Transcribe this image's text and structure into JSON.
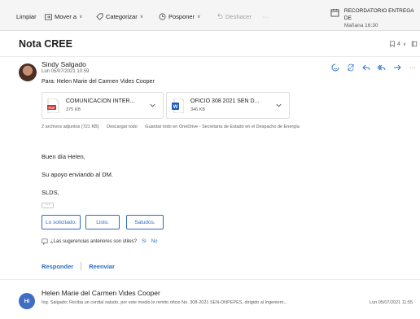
{
  "toolbar": {
    "limpiar": "Limpiar",
    "mover": "Mover a",
    "categorizar": "Categorizar",
    "posponer": "Posponer",
    "deshacer": "Deshacer",
    "more": "···",
    "reminder_title": "RECORDATORIO ENTREGA DE",
    "reminder_time": "Mañana 16:30"
  },
  "subject": {
    "title": "Nota CREE",
    "count": "4"
  },
  "message": {
    "sender": "Sindy Salgado",
    "date": "Lun 05/07/2021 10:59",
    "to": "Para:  Helen Marie del Carmen Vides Cooper",
    "attachments": [
      {
        "name": "COMUNICACION INTER...",
        "size": "375 KB",
        "type": "pdf"
      },
      {
        "name": "OFICIO 308 2021 SEN D...",
        "size": "346 KB",
        "type": "word"
      }
    ],
    "attachments_summary": {
      "count": "2 archivos adjuntos (721 KB)",
      "download": "Descargar todo",
      "save": "Guardar todo en OneDrive - Secretaría de Estado en el Despacho de Energía"
    },
    "body": {
      "greeting": "Buen día Helen,",
      "line1": "Su apoyo enviando al DM.",
      "closing": "SLDS,"
    },
    "ellipsis": "···",
    "suggestions": [
      "Lo solicitado.",
      "Listo.",
      "Saludos."
    ],
    "feedback": {
      "question": "¿Las sugerencias anteriores son útiles?",
      "yes": "Sí",
      "no": "No"
    },
    "reply": "Responder",
    "forward": "Reenviar"
  },
  "next_message": {
    "initials": "HI",
    "sender": "Helen Marie del Carmen Vides Cooper",
    "preview": "Ing. Salgado: Reciba un cordial saludo, por este medio le remito oficio No. 308-2021 SEN-DNPEPES, dirigido al Ingeniero...",
    "date": "Lun 05/07/2021 11:55"
  },
  "colors": {
    "accent": "#2b6ec2",
    "toolbar_bg": "#f5f5f5",
    "pdf_red": "#d13438",
    "word_blue": "#185abd"
  }
}
